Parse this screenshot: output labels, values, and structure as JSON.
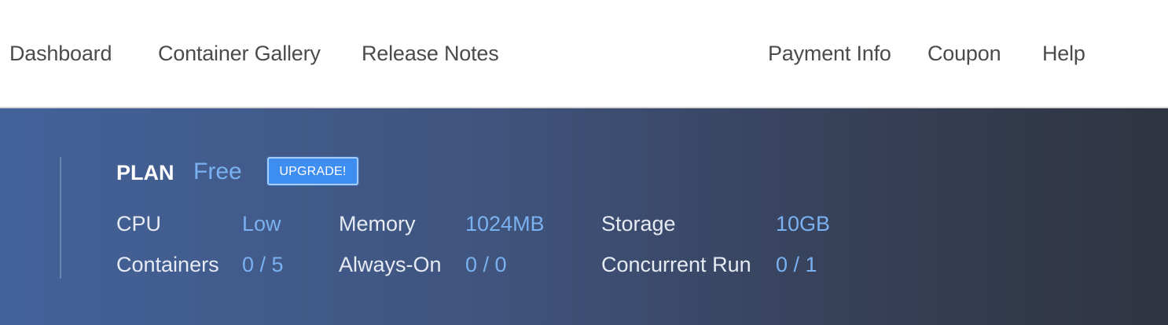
{
  "nav": {
    "left": [
      "Dashboard",
      "Container Gallery",
      "Release Notes"
    ],
    "right": [
      "Payment Info",
      "Coupon",
      "Help"
    ]
  },
  "plan": {
    "label": "PLAN",
    "value": "Free",
    "upgrade_label": "UPGRADE!"
  },
  "stats": {
    "cpu": {
      "label": "CPU",
      "value": "Low"
    },
    "memory": {
      "label": "Memory",
      "value": "1024MB"
    },
    "storage": {
      "label": "Storage",
      "value": "10GB"
    },
    "containers": {
      "label": "Containers",
      "value": "0 / 5"
    },
    "always_on": {
      "label": "Always-On",
      "value": "0 / 0"
    },
    "concurrent_run": {
      "label": "Concurrent Run",
      "value": "0 / 1"
    }
  },
  "colors": {
    "accent": "#7ab1f0",
    "button": "#3d8ef0",
    "banner_start": "#43629a",
    "banner_end": "#2f3441"
  }
}
